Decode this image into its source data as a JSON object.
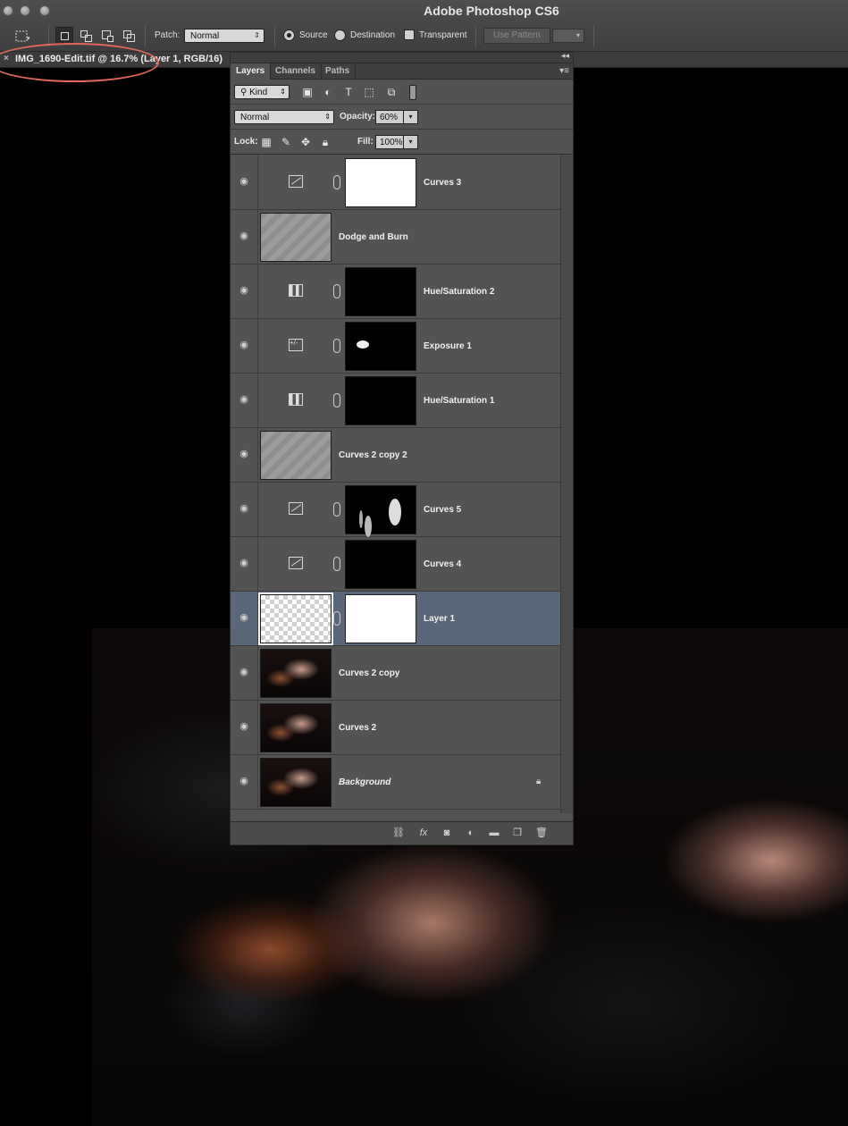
{
  "window": {
    "title": "Adobe Photoshop CS6",
    "traffic_lights": [
      "close-light",
      "minimize-light",
      "zoom-light"
    ]
  },
  "options_bar": {
    "tool_icon": "patch-tool-icon",
    "patch_label": "Patch:",
    "patch_mode": "Normal",
    "source_label": "Source",
    "destination_label": "Destination",
    "transparent_label": "Transparent",
    "use_pattern_label": "Use Pattern",
    "source_selected": true
  },
  "document_tab": {
    "title": "IMG_1690-Edit.tif @ 16.7% (Layer 1, RGB/16)",
    "close_glyph": "×"
  },
  "layers_panel": {
    "tabs": [
      "Layers",
      "Channels",
      "Paths"
    ],
    "active_tab": "Layers",
    "filter_kind": "Kind",
    "blend_mode": "Normal",
    "opacity_label": "Opacity:",
    "opacity_value": "60%",
    "lock_label": "Lock:",
    "fill_label": "Fill:",
    "fill_value": "100%",
    "layers": [
      {
        "name": "Curves 3",
        "type": "curves-adjustment",
        "mask": "white",
        "visible": true
      },
      {
        "name": "Dodge and Burn",
        "type": "pixel",
        "thumb": "gray",
        "visible": true
      },
      {
        "name": "Hue/Saturation 2",
        "type": "hue-saturation-adjustment",
        "mask": "black",
        "visible": true
      },
      {
        "name": "Exposure 1",
        "type": "exposure-adjustment",
        "mask": "black-blob",
        "visible": true
      },
      {
        "name": "Hue/Saturation 1",
        "type": "hue-saturation-adjustment",
        "mask": "black",
        "visible": true
      },
      {
        "name": "Curves 2 copy 2",
        "type": "pixel",
        "thumb": "gray",
        "visible": true
      },
      {
        "name": "Curves 5",
        "type": "curves-adjustment",
        "mask": "black-shapes",
        "visible": true
      },
      {
        "name": "Curves 4",
        "type": "curves-adjustment",
        "mask": "black",
        "visible": true
      },
      {
        "name": "Layer 1",
        "type": "pixel-with-mask",
        "thumb": "transparent",
        "mask": "white",
        "visible": true,
        "selected": true
      },
      {
        "name": "Curves 2 copy",
        "type": "pixel",
        "thumb": "photo",
        "visible": true
      },
      {
        "name": "Curves 2",
        "type": "pixel",
        "thumb": "photo",
        "visible": true
      },
      {
        "name": "Background",
        "type": "background",
        "thumb": "photo",
        "visible": true,
        "locked": true
      }
    ],
    "footer_icons": [
      "link-layers-icon",
      "fx-icon",
      "add-mask-icon",
      "adjustment-layer-icon",
      "new-group-icon",
      "new-layer-icon",
      "trash-icon"
    ]
  },
  "colors": {
    "selected_layer": "#596779",
    "annotation_ring": "#e2675c",
    "panel_bg": "#535353"
  }
}
